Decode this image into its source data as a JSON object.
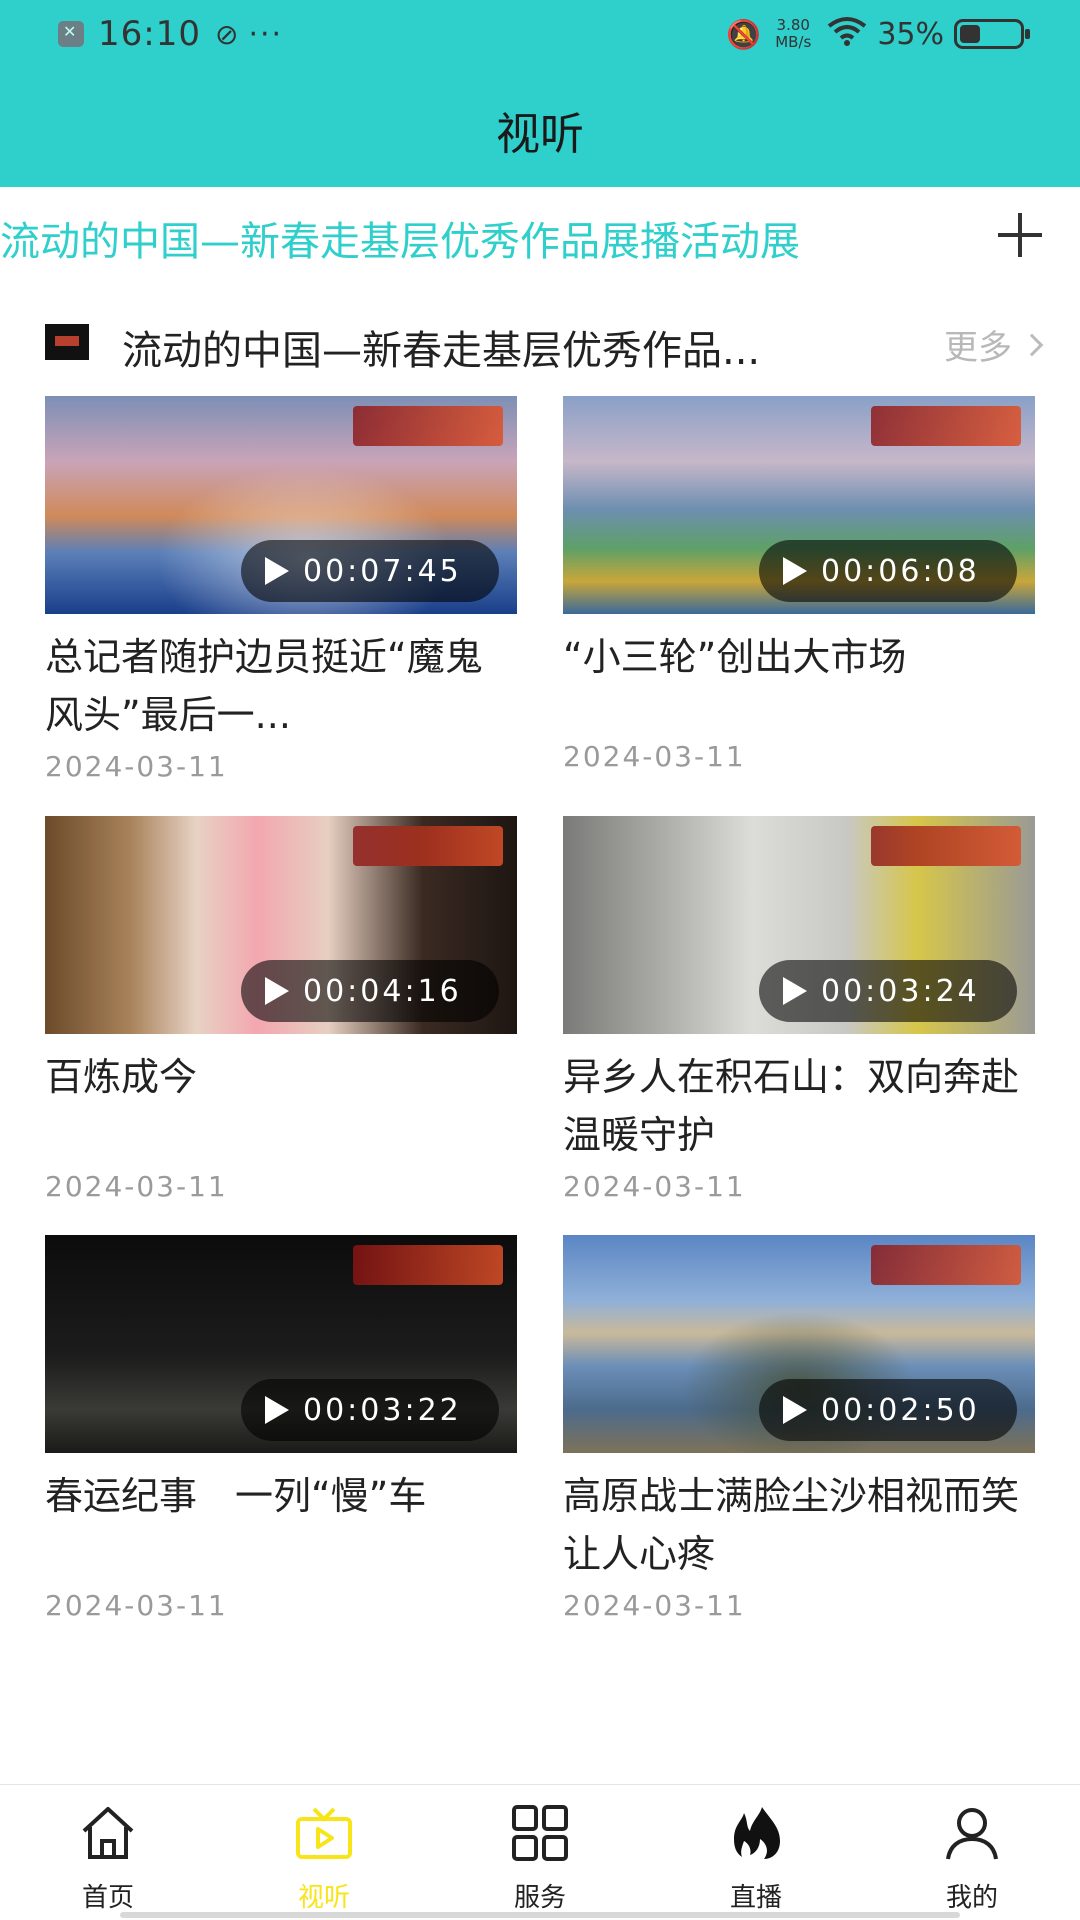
{
  "status_bar": {
    "time": "16:10",
    "speed_value": "3.80",
    "speed_unit": "MB/s",
    "battery_percent": "35%",
    "battery_level": 0.35,
    "icons": [
      "app-notification-icon",
      "focus-icon",
      "more-dots-icon",
      "mute-icon",
      "wifi-icon",
      "battery-icon"
    ]
  },
  "header": {
    "title": "视听"
  },
  "category_bar": {
    "label": "流动的中国—新春走基层优秀作品展播活动展",
    "add_icon": "plus-icon"
  },
  "section": {
    "title": "流动的中国—新春走基层优秀作品...",
    "more_label": "更多"
  },
  "videos": [
    {
      "title": "总记者随护边员挺近“魔鬼风头”最后一...",
      "date": "2024-03-11",
      "duration": "00:07:45"
    },
    {
      "title": "“小三轮”创出大市场",
      "date": "2024-03-11",
      "duration": "00:06:08"
    },
    {
      "title": "百炼成今",
      "date": "2024-03-11",
      "duration": "00:04:16"
    },
    {
      "title": "异乡人在积石山：双向奔赴　温暖守护",
      "date": "2024-03-11",
      "duration": "00:03:24"
    },
    {
      "title": "春运纪事　一列“慢”车",
      "date": "2024-03-11",
      "duration": "00:03:22"
    },
    {
      "title": "高原战士满脸尘沙相视而笑让人心疼",
      "date": "2024-03-11",
      "duration": "00:02:50"
    }
  ],
  "tab_bar": {
    "active": "视听",
    "items": [
      {
        "label": "首页",
        "icon": "home-icon"
      },
      {
        "label": "视听",
        "icon": "tv-play-icon"
      },
      {
        "label": "服务",
        "icon": "grid-icon"
      },
      {
        "label": "直播",
        "icon": "flame-icon"
      },
      {
        "label": "我的",
        "icon": "person-icon"
      }
    ]
  },
  "colors": {
    "accent": "#2fcfcb",
    "active_tab": "#f7e51a",
    "date": "#9a9a9a"
  }
}
